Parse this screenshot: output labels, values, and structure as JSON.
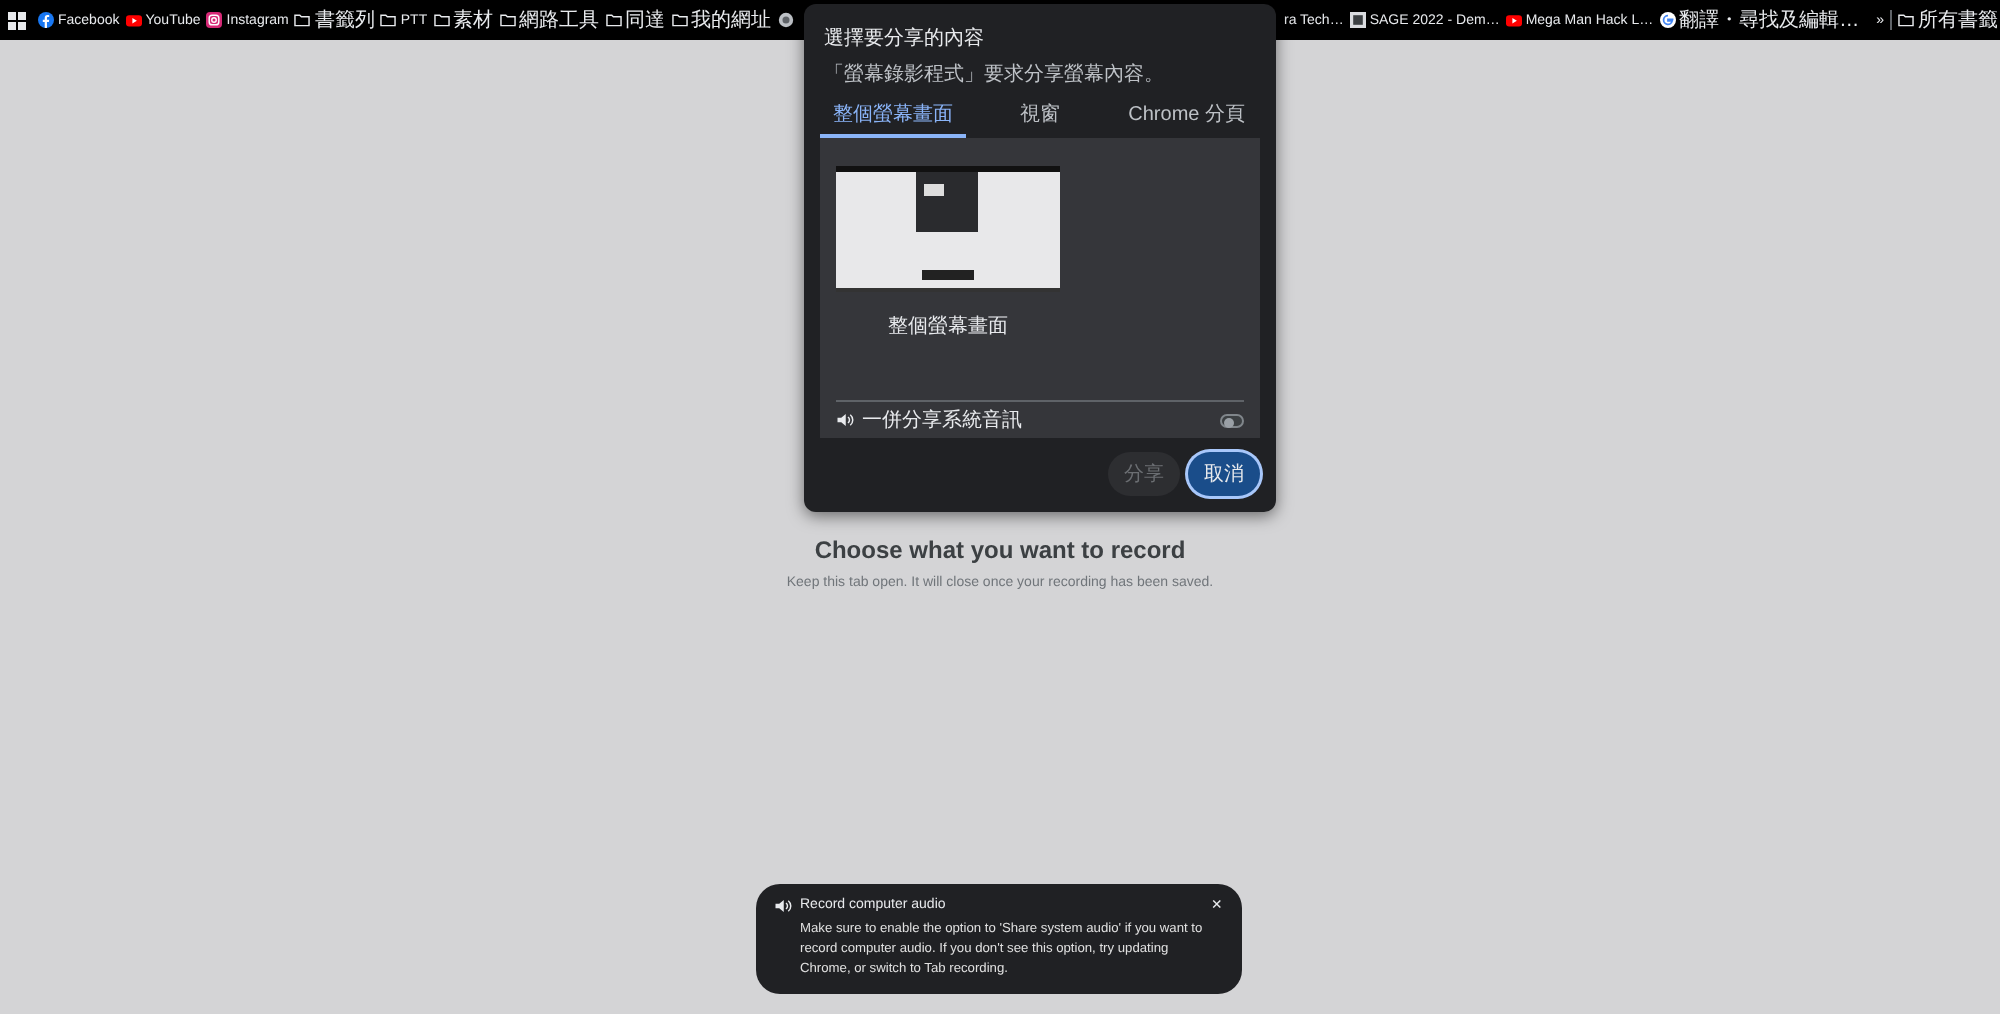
{
  "bookmarks_bar": {
    "left": [
      {
        "kind": "facebook",
        "label": "Facebook"
      },
      {
        "kind": "youtube",
        "label": "YouTube"
      },
      {
        "kind": "instagram",
        "label": "Instagram"
      },
      {
        "kind": "folder",
        "label": "書籤列"
      },
      {
        "kind": "folder",
        "label": "PTT"
      },
      {
        "kind": "folder",
        "label": "素材"
      },
      {
        "kind": "folder",
        "label": "網路工具"
      },
      {
        "kind": "folder",
        "label": "同達"
      },
      {
        "kind": "folder",
        "label": "我的網址"
      },
      {
        "kind": "globe"
      }
    ],
    "right": [
      {
        "kind": "plain",
        "label": "ra Tech…"
      },
      {
        "kind": "sage",
        "label": "SAGE 2022 - Dem…"
      },
      {
        "kind": "youtube",
        "label": "Mega Man Hack L…"
      },
      {
        "kind": "google",
        "label": "翻譯・尋找及編輯…"
      }
    ],
    "overflow": "»",
    "all_bookmarks": "所有書籤"
  },
  "dialog": {
    "title": "選擇要分享的內容",
    "subtitle": "「螢幕錄影程式」要求分享螢幕內容。",
    "tabs": [
      {
        "label": "整個螢幕畫面",
        "selected": true
      },
      {
        "label": "視窗",
        "selected": false
      },
      {
        "label": "Chrome 分頁",
        "selected": false
      }
    ],
    "sources": [
      {
        "label": "整個螢幕畫面"
      }
    ],
    "audio": {
      "label": "一併分享系統音訊",
      "on": false
    },
    "buttons": [
      {
        "label": "分享",
        "kind": "secondary",
        "disabled": true
      },
      {
        "label": "取消",
        "kind": "primary",
        "disabled": false
      }
    ]
  },
  "page": {
    "heading": "Choose what you want to record",
    "subtext": "Keep this tab open. It will close once your recording has been saved."
  },
  "toast": {
    "title": "Record computer audio",
    "close": "×",
    "body": "Make sure to enable the option to 'Share system audio' if you want to record computer audio. If you don't see this option, try updating Chrome, or switch to Tab recording."
  }
}
